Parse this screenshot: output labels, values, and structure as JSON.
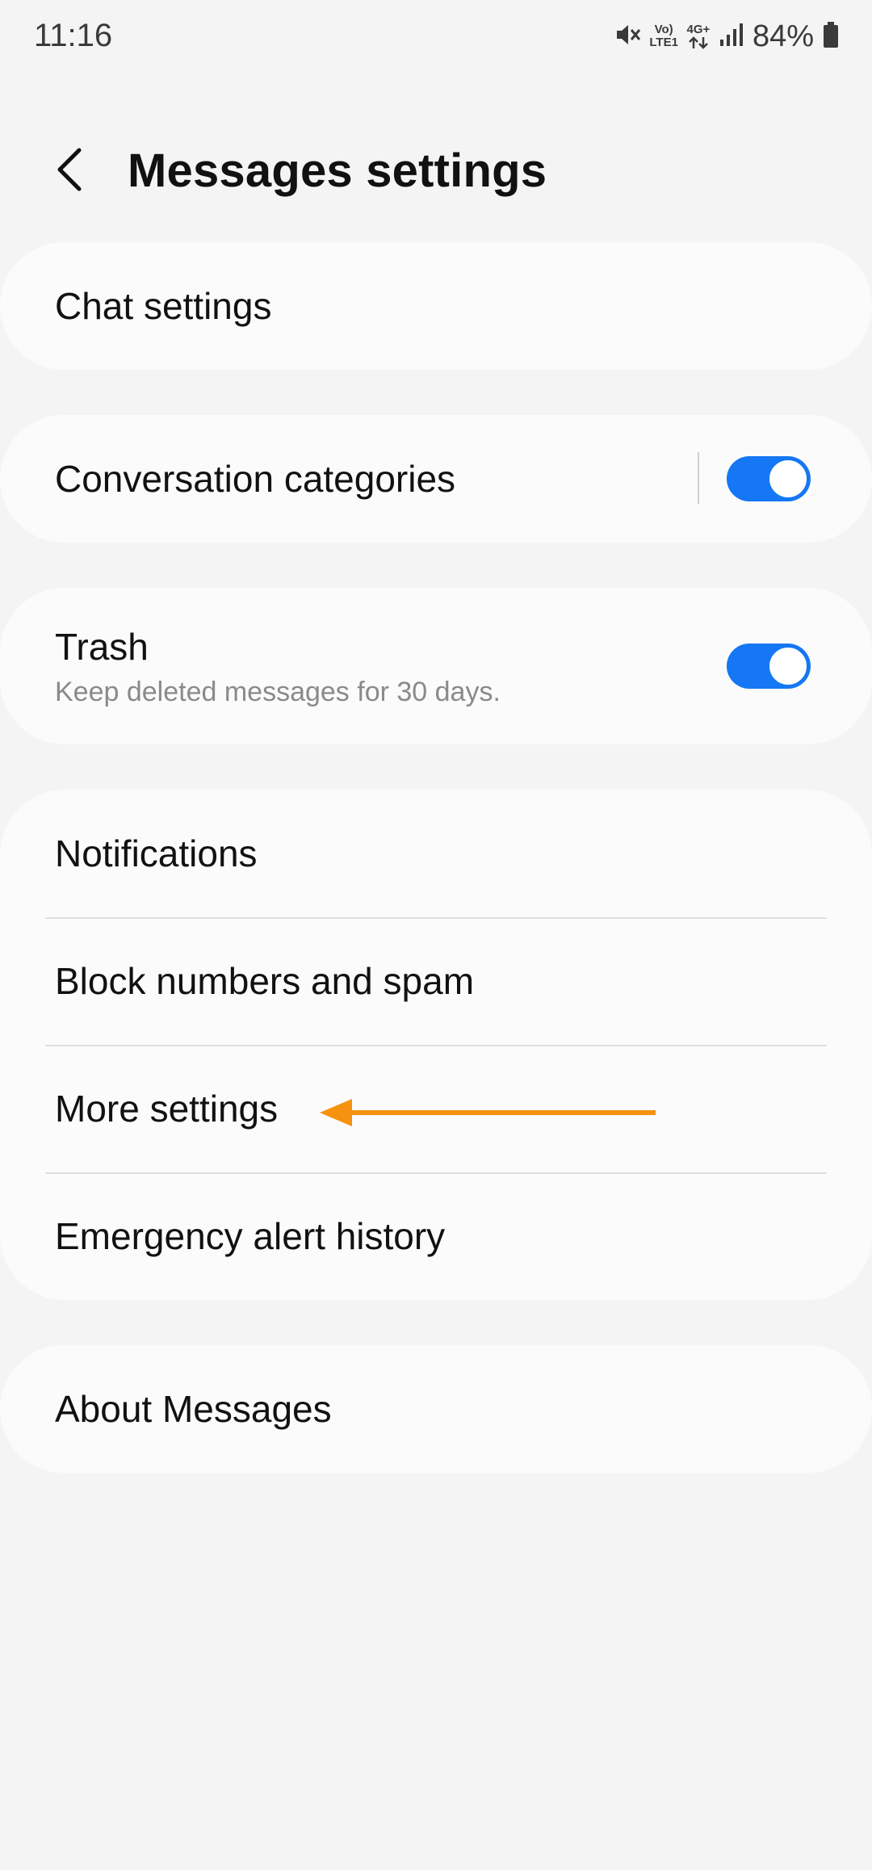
{
  "status_bar": {
    "time": "11:16",
    "volte_top": "Vo)",
    "volte_bottom": "LTE1",
    "network": "4G+",
    "battery_percent": "84%",
    "icons": [
      "mute-icon",
      "volte-icon",
      "data-arrows-icon",
      "signal-icon",
      "battery-icon"
    ]
  },
  "header": {
    "title": "Messages settings",
    "back_icon": "chevron-left-icon"
  },
  "settings": {
    "chat_settings": "Chat settings",
    "conversation_categories": {
      "label": "Conversation categories",
      "enabled": true
    },
    "trash": {
      "label": "Trash",
      "subtitle": "Keep deleted messages for 30 days.",
      "enabled": true
    },
    "group": [
      {
        "label": "Notifications"
      },
      {
        "label": "Block numbers and spam"
      },
      {
        "label": "More settings"
      },
      {
        "label": "Emergency alert history"
      }
    ],
    "about": "About Messages"
  },
  "colors": {
    "background": "#f4f4f4",
    "card": "#fbfbfb",
    "toggle_on": "#1577f3",
    "annotation_arrow": "#f5920f"
  }
}
